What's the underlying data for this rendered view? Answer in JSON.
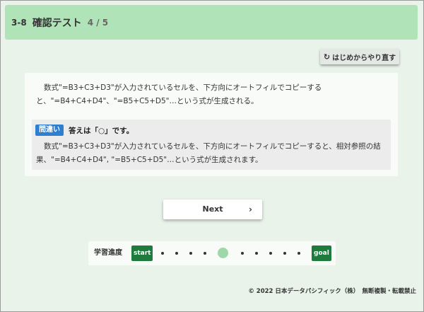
{
  "header": {
    "section": "3-8",
    "title": "確認テスト",
    "progress": "4 / 5"
  },
  "toolbar": {
    "restart_icon": "refresh-icon",
    "restart_label": "はじめからやり直す"
  },
  "question": {
    "text": "数式\"=B3+C3+D3\"が入力されているセルを、下方向にオートフィルでコピーすると、\"=B4+C4+D4\"、\"=B5+C5+D5\"…という式が生成される。"
  },
  "feedback": {
    "badge": "間違い",
    "badge_color": "#2f7fd0",
    "answer": "答えは「○」です。",
    "explanation": "数式\"=B3+C3+D3\"が入力されているセルを、下方向にオートフィルでコピーすると、相対参照の結果、\"=B4+C4+D4\", \"=B5+C5+D5\"…という式が生成されます。"
  },
  "navigation": {
    "next_label": "Next",
    "next_icon": "chevron-right-icon"
  },
  "tracker": {
    "label": "学習進度",
    "start": "start",
    "goal": "goal",
    "total_steps": 10,
    "current_step": 5,
    "accent_color": "#1f7a3e"
  },
  "footer": {
    "copyright": "© 2022 日本データパシフィック（株）　無断複製・転載禁止"
  }
}
